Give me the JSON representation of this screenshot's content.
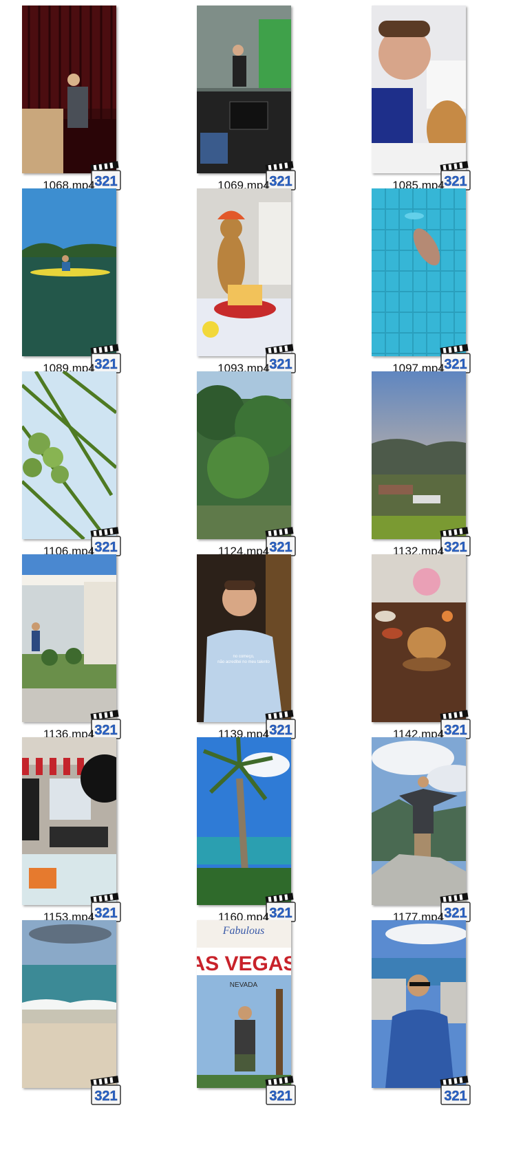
{
  "files": [
    {
      "name": "1068.mp4",
      "scene": "stage-speaker"
    },
    {
      "name": "1069.mp4",
      "scene": "studio-presenter"
    },
    {
      "name": "1085.mp4",
      "scene": "man-with-dog"
    },
    {
      "name": "1089.mp4",
      "scene": "kayak-lake"
    },
    {
      "name": "1093.mp4",
      "scene": "dog-birthday"
    },
    {
      "name": "1097.mp4",
      "scene": "pool-swimmer"
    },
    {
      "name": "1106.mp4",
      "scene": "coconut-palm"
    },
    {
      "name": "1124.mp4",
      "scene": "forest-river"
    },
    {
      "name": "1132.mp4",
      "scene": "hill-town-sunset"
    },
    {
      "name": "1136.mp4",
      "scene": "colonial-porch"
    },
    {
      "name": "1139.mp4",
      "scene": "man-talking"
    },
    {
      "name": "1142.mp4",
      "scene": "breakfast-table"
    },
    {
      "name": "1153.mp4",
      "scene": "market-stall"
    },
    {
      "name": "1160.mp4",
      "scene": "palm-sea"
    },
    {
      "name": "1177.mp4",
      "scene": "mountain-top"
    },
    {
      "name": "",
      "scene": "beach-waves"
    },
    {
      "name": "",
      "scene": "las-vegas-sign"
    },
    {
      "name": "",
      "scene": "man-by-sea"
    }
  ],
  "badge": {
    "text": "321",
    "icon": "media-player-classic-icon"
  },
  "caption_1139": "no começo, não acreditei no meu talento"
}
